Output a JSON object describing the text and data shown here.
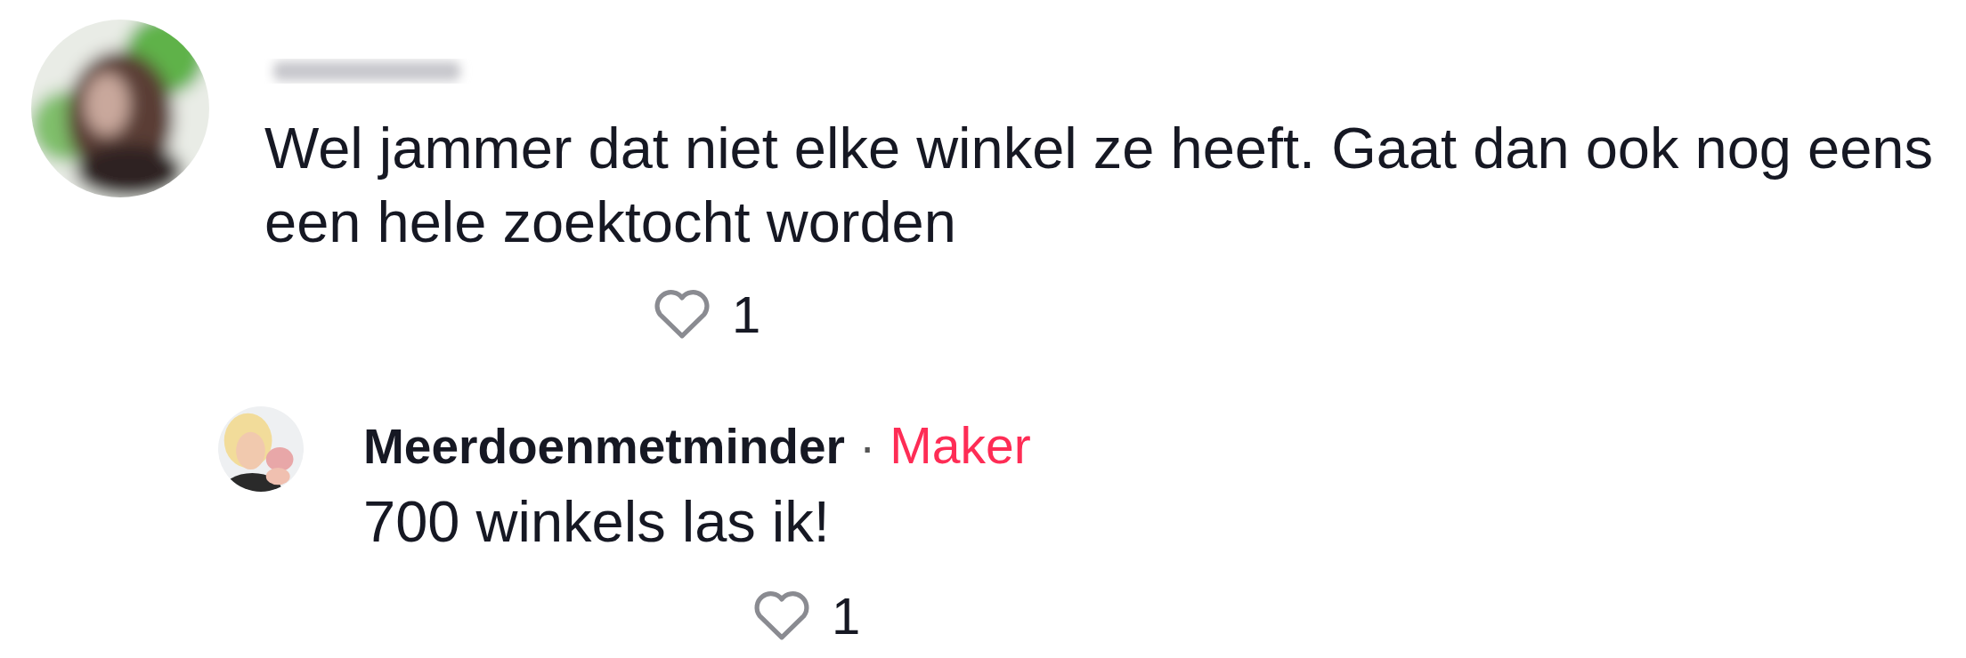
{
  "comment": {
    "text_lines": [
      "Wel jammer dat niet elke winkel ze heeft. Gaat dan ook nog eens",
      "een hele zoektocht worden"
    ],
    "likes": "1"
  },
  "reply": {
    "author": "Meerdoenmetminder",
    "separator": "·",
    "badge": "Maker",
    "text": "700 winkels las ik!",
    "likes": "1"
  }
}
